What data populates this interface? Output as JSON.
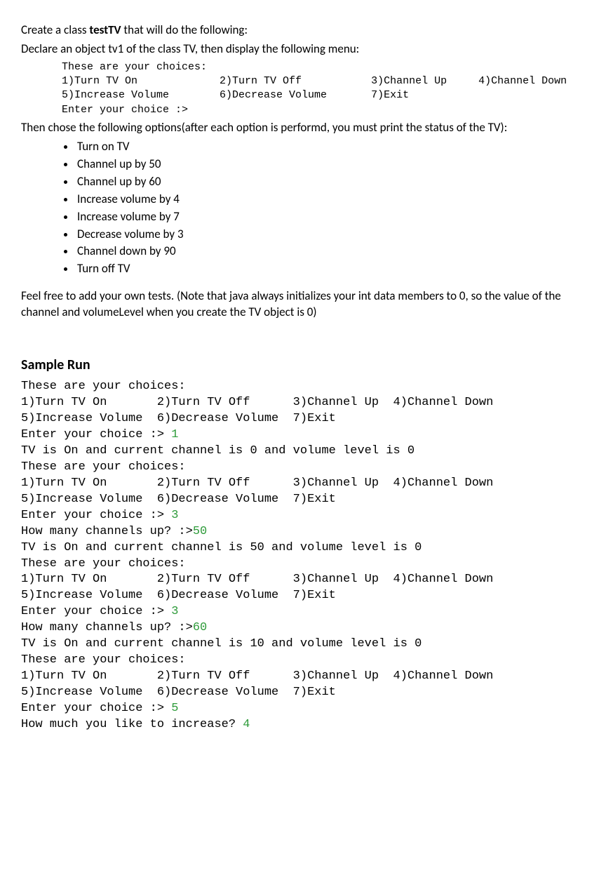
{
  "intro": {
    "line_pre": "Create a class ",
    "class_name": "testTV",
    "line_post": " that will do the following:"
  },
  "declare_line": "Declare an object tv1 of the class TV, then display the following menu:",
  "menu_block": "These are your choices:\n1)Turn TV On             2)Turn TV Off           3)Channel Up     4)Channel Down\n5)Increase Volume        6)Decrease Volume       7)Exit\nEnter your choice :>",
  "then_paragraph": "Then chose the following options(after each option is performd, you must print the status of the TV):",
  "bullets": [
    "Turn on TV",
    "Channel up by 50",
    "Channel up by 60",
    "Increase volume by 4",
    "Increase volume by 7",
    "Decrease volume by 3",
    "Channel down by 90",
    "Turn off TV"
  ],
  "note_paragraph": "Feel free to add your own tests. (Note that java always initializes your int data members to 0, so the value of the channel and volumeLevel when you create the TV object is 0)",
  "sample_heading": "Sample Run",
  "sample_run": [
    {
      "t": "These are your choices:"
    },
    {
      "t": "1)Turn TV On       2)Turn TV Off      3)Channel Up  4)Channel Down"
    },
    {
      "t": "5)Increase Volume  6)Decrease Volume  7)Exit"
    },
    {
      "t": "Enter your choice :> ",
      "in": "1"
    },
    {
      "t": "TV is On and current channel is 0 and volume level is 0"
    },
    {
      "t": "These are your choices:"
    },
    {
      "t": "1)Turn TV On       2)Turn TV Off      3)Channel Up  4)Channel Down"
    },
    {
      "t": "5)Increase Volume  6)Decrease Volume  7)Exit"
    },
    {
      "t": "Enter your choice :> ",
      "in": "3"
    },
    {
      "t": "How many channels up? :>",
      "in": "50"
    },
    {
      "t": "TV is On and current channel is 50 and volume level is 0"
    },
    {
      "t": "These are your choices:"
    },
    {
      "t": "1)Turn TV On       2)Turn TV Off      3)Channel Up  4)Channel Down"
    },
    {
      "t": "5)Increase Volume  6)Decrease Volume  7)Exit"
    },
    {
      "t": "Enter your choice :> ",
      "in": "3"
    },
    {
      "t": "How many channels up? :>",
      "in": "60"
    },
    {
      "t": "TV is On and current channel is 10 and volume level is 0"
    },
    {
      "t": "These are your choices:"
    },
    {
      "t": "1)Turn TV On       2)Turn TV Off      3)Channel Up  4)Channel Down"
    },
    {
      "t": "5)Increase Volume  6)Decrease Volume  7)Exit"
    },
    {
      "t": "Enter your choice :> ",
      "in": "5"
    },
    {
      "t": "How much you like to increase? ",
      "in": "4"
    }
  ]
}
